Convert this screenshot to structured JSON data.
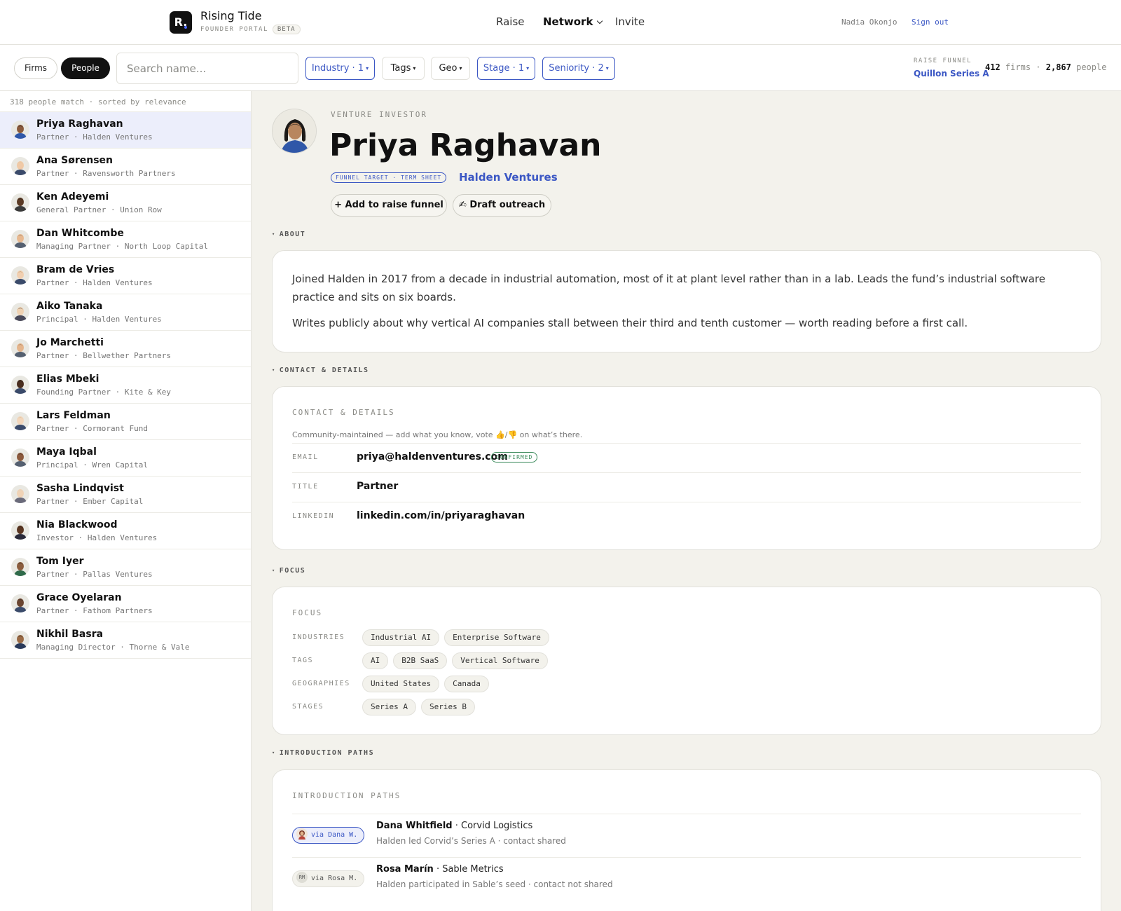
{
  "header": {
    "logo_letter": "R.",
    "app_name": "Rising Tide",
    "app_sub": "FOUNDER PORTAL",
    "beta": "BETA",
    "nav": [
      {
        "label": "Raise"
      },
      {
        "label": "Network"
      },
      {
        "label": "Invite"
      }
    ],
    "user_name": "Nadia Okonjo",
    "sign_out": "Sign out"
  },
  "filters": {
    "segments": [
      "Firms",
      "People"
    ],
    "search_placeholder": "Search name...",
    "chips": [
      "Industry · 1",
      "Tags",
      "Geo",
      "Stage · 1",
      "Seniority · 2"
    ],
    "raise_funnel_label": "RAISE FUNNEL",
    "raise_funnel_link": "Quillon Series A",
    "firms_count": "412",
    "firms_word": "firms",
    "people_count": "2,867",
    "people_word": "people",
    "sep": "·"
  },
  "list": {
    "summary": "318 people match · sorted by relevance",
    "people": [
      {
        "name": "Priya Raghavan",
        "sub": "Partner · Halden Ventures"
      },
      {
        "name": "Ana Sørensen",
        "sub": "Partner · Ravensworth Partners"
      },
      {
        "name": "Ken Adeyemi",
        "sub": "General Partner · Union Row"
      },
      {
        "name": "Dan Whitcombe",
        "sub": "Managing Partner · North Loop Capital"
      },
      {
        "name": "Bram de Vries",
        "sub": "Partner · Halden Ventures"
      },
      {
        "name": "Aiko Tanaka",
        "sub": "Principal · Halden Ventures"
      },
      {
        "name": "Jo Marchetti",
        "sub": "Partner · Bellwether Partners"
      },
      {
        "name": "Elias Mbeki",
        "sub": "Founding Partner · Kite & Key"
      },
      {
        "name": "Lars Feldman",
        "sub": "Partner · Cormorant Fund"
      },
      {
        "name": "Maya Iqbal",
        "sub": "Principal · Wren Capital"
      },
      {
        "name": "Sasha Lindqvist",
        "sub": "Partner · Ember Capital"
      },
      {
        "name": "Nia Blackwood",
        "sub": "Investor · Halden Ventures"
      },
      {
        "name": "Tom Iyer",
        "sub": "Partner · Pallas Ventures"
      },
      {
        "name": "Grace Oyelaran",
        "sub": "Partner · Fathom Partners"
      },
      {
        "name": "Nikhil Basra",
        "sub": "Managing Director · Thorne & Vale"
      }
    ]
  },
  "profile": {
    "kicker": "VENTURE INVESTOR",
    "name": "Priya Raghavan",
    "funnel_badge": "FUNNEL TARGET · TERM SHEET",
    "firm": "Halden Ventures",
    "btn_add": "+ Add to raise funnel",
    "btn_draft": "✍ Draft outreach",
    "toggle_glyph": "▾",
    "about": {
      "label": "ABOUT",
      "p1": "Joined Halden in 2017 from a decade in industrial automation, most of it at plant level rather than in a lab. Leads the fund’s industrial software practice and sits on six boards.",
      "p2": "Writes publicly about why vertical AI companies stall between their third and tenth customer — worth reading before a first call."
    },
    "contact": {
      "label": "CONTACT & DETAILS",
      "title": "CONTACT & DETAILS",
      "hint": "Community-maintained — add what you know, vote 👍/👎 on what’s there.",
      "email_label": "EMAIL",
      "email": "priya@haldenventures.com",
      "confirmed": "CONFIRMED",
      "title_label": "TITLE",
      "title_value": "Partner",
      "linkedin_label": "LINKEDIN",
      "linkedin": "linkedin.com/in/priyaraghavan"
    },
    "focus": {
      "label": "FOCUS",
      "title": "FOCUS",
      "industries_label": "INDUSTRIES",
      "industries": [
        "Industrial AI",
        "Enterprise Software"
      ],
      "tags_label": "TAGS",
      "tags": [
        "AI",
        "B2B SaaS",
        "Vertical Software"
      ],
      "geos_label": "GEOGRAPHIES",
      "geos": [
        "United States",
        "Canada"
      ],
      "stages_label": "STAGES",
      "stages": [
        "Series A",
        "Series B"
      ]
    },
    "intro": {
      "label": "INTRODUCTION PATHS",
      "title": "INTRODUCTION PATHS",
      "paths": [
        {
          "via": "via Dana W.",
          "name": "Dana Whitfield",
          "sep": " · ",
          "org": "Corvid Logistics",
          "note": "Halden led Corvid’s Series A · contact shared"
        },
        {
          "via": "via Rosa M.",
          "initials": "RM",
          "name": "Rosa Marín",
          "sep": " · ",
          "org": "Sable Metrics",
          "note": "Halden participated in Sable’s seed · contact not shared"
        }
      ]
    }
  }
}
